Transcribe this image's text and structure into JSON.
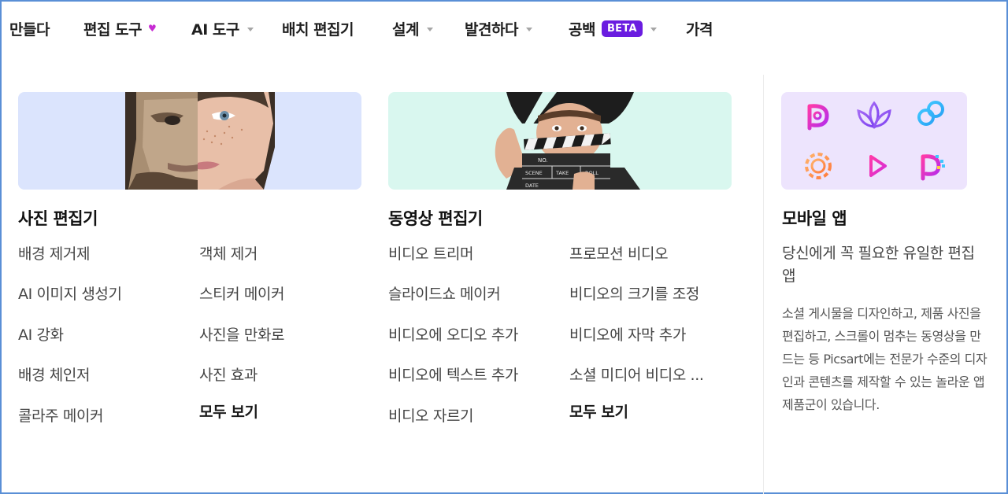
{
  "nav": {
    "items": [
      {
        "label": "만들다"
      },
      {
        "label": "편집 도구"
      },
      {
        "label": "AI 도구"
      },
      {
        "label": "배치 편집기"
      },
      {
        "label": "설계"
      },
      {
        "label": "발견하다"
      },
      {
        "label": "공백",
        "badge": "BETA"
      },
      {
        "label": "가격"
      }
    ]
  },
  "photo_editor": {
    "title": "사진 편집기",
    "col1": [
      "배경 제거제",
      "AI 이미지 생성기",
      "AI 강화",
      "배경 체인저",
      "콜라주 메이커"
    ],
    "col2": [
      "객체 제거",
      "스티커 메이커",
      "사진을 만화로",
      "사진 효과"
    ],
    "see_all": "모두 보기"
  },
  "video_editor": {
    "title": "동영상 편집기",
    "col1": [
      "비디오 트리머",
      "슬라이드쇼 메이커",
      "비디오에 오디오 추가",
      "비디오에 텍스트 추가",
      "비디오 자르기"
    ],
    "col2": [
      "프로모션 비디오",
      "비디오의 크기를 조정",
      "비디오에 자막 추가",
      "소셜 미디어 비디오 ..."
    ],
    "see_all": "모두 보기",
    "clapboard": {
      "scene": "NO.",
      "scene2": "SCENE",
      "take": "TAKE",
      "roll": "ROLL",
      "date": "DATE"
    }
  },
  "mobile": {
    "title": "모바일 앱",
    "subtitle": "당신에게 꼭 필요한 유일한 편집 앱",
    "description": "소셜 게시물을 디자인하고, 제품 사진을 편집하고, 스크롤이 멈추는 동영상을 만드는 등 Picsart에는 전문가 수준의 디자인과 콘텐츠를 제작할 수 있는 놀라운 앱 제품군이 있습니다."
  },
  "colors": {
    "accent": "#6a1ce0",
    "heart": "#c72bd3",
    "photo_bg": "#dbe4fd",
    "video_bg": "#d9f7ef",
    "apps_bg": "#ede4fd"
  }
}
